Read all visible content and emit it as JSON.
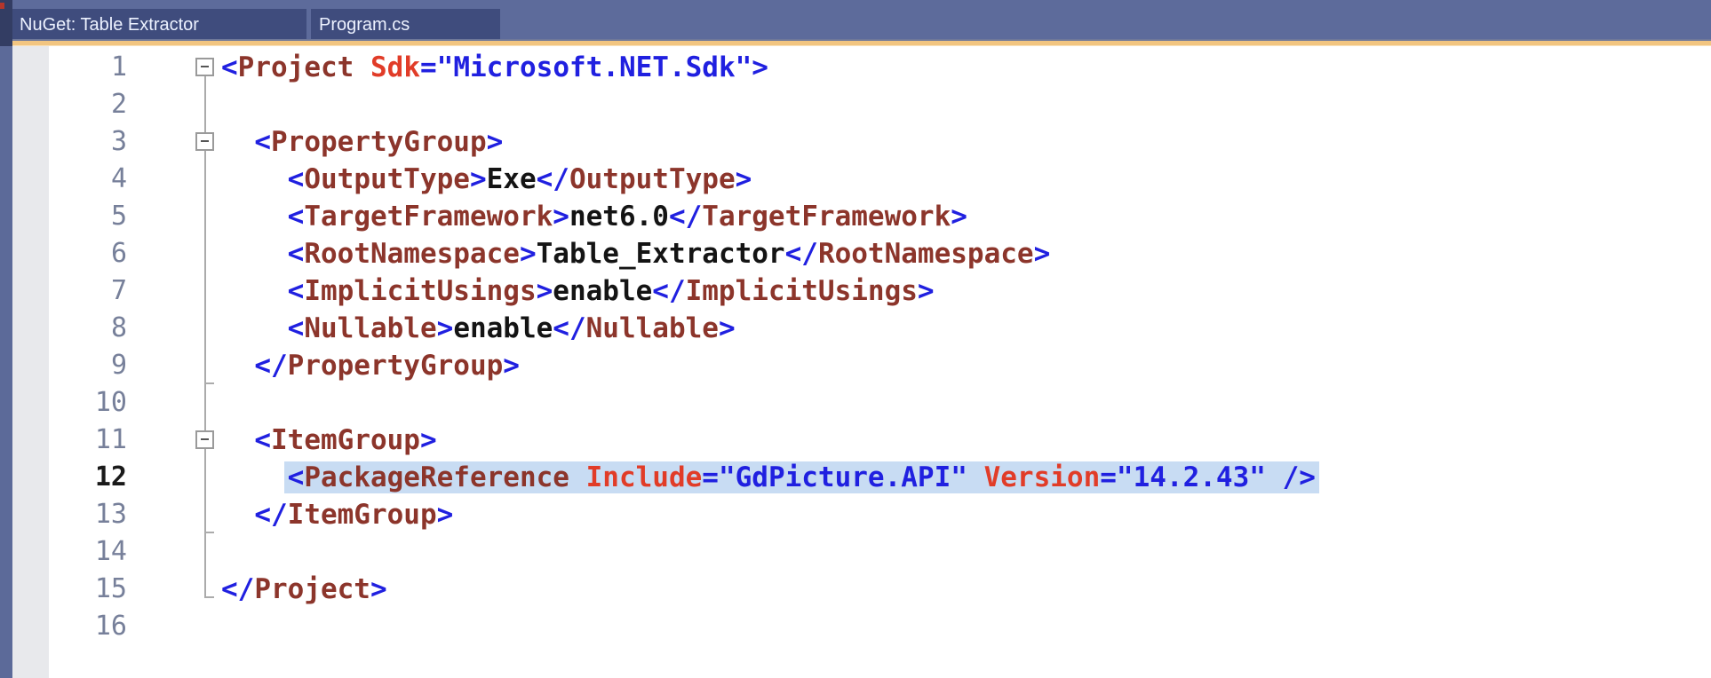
{
  "tabs": [
    {
      "label": "NuGet: Table Extractor",
      "active": true
    },
    {
      "label": "Program.cs",
      "active": false
    }
  ],
  "colors": {
    "tabbar_bg": "#5D6B9B",
    "tab_bg": "#3F4C7D",
    "tab_text": "#EDF2FF",
    "accent_border": "#F2C580",
    "window_left_edge": "#333D63",
    "editor_left_strip": "#5C6A99",
    "glyph_margin": "#E8E9EC",
    "editor_bg": "#FFFFFF",
    "line_number": "#77809A",
    "line_number_active": "#1A1A1A",
    "fold_gray": "#ABABAB",
    "selection_highlight": "#C8DCF3",
    "syntax_delimiter": "#2020E0",
    "syntax_element": "#8C352B",
    "syntax_attribute": "#E13C28",
    "syntax_value": "#2020E0",
    "syntax_text": "#141414"
  },
  "editor": {
    "language": "xml-csproj",
    "lines": [
      {
        "n": "1",
        "fold": "box-first",
        "tokens": [
          [
            "d",
            "<"
          ],
          [
            "e",
            "Project"
          ],
          [
            "w",
            " "
          ],
          [
            "a",
            "Sdk"
          ],
          [
            "d",
            "="
          ],
          [
            "v",
            "\"Microsoft.NET.Sdk\""
          ],
          [
            "d",
            ">"
          ]
        ]
      },
      {
        "n": "2",
        "fold": "line",
        "tokens": []
      },
      {
        "n": "3",
        "fold": "box",
        "tokens": [
          [
            "w",
            "  "
          ],
          [
            "d",
            "<"
          ],
          [
            "e",
            "PropertyGroup"
          ],
          [
            "d",
            ">"
          ]
        ]
      },
      {
        "n": "4",
        "fold": "line",
        "tokens": [
          [
            "w",
            "    "
          ],
          [
            "d",
            "<"
          ],
          [
            "e",
            "OutputType"
          ],
          [
            "d",
            ">"
          ],
          [
            "x",
            "Exe"
          ],
          [
            "d",
            "</"
          ],
          [
            "e",
            "OutputType"
          ],
          [
            "d",
            ">"
          ]
        ]
      },
      {
        "n": "5",
        "fold": "line",
        "tokens": [
          [
            "w",
            "    "
          ],
          [
            "d",
            "<"
          ],
          [
            "e",
            "TargetFramework"
          ],
          [
            "d",
            ">"
          ],
          [
            "x",
            "net6.0"
          ],
          [
            "d",
            "</"
          ],
          [
            "e",
            "TargetFramework"
          ],
          [
            "d",
            ">"
          ]
        ]
      },
      {
        "n": "6",
        "fold": "line",
        "tokens": [
          [
            "w",
            "    "
          ],
          [
            "d",
            "<"
          ],
          [
            "e",
            "RootNamespace"
          ],
          [
            "d",
            ">"
          ],
          [
            "x",
            "Table_Extractor"
          ],
          [
            "d",
            "</"
          ],
          [
            "e",
            "RootNamespace"
          ],
          [
            "d",
            ">"
          ]
        ]
      },
      {
        "n": "7",
        "fold": "line",
        "tokens": [
          [
            "w",
            "    "
          ],
          [
            "d",
            "<"
          ],
          [
            "e",
            "ImplicitUsings"
          ],
          [
            "d",
            ">"
          ],
          [
            "x",
            "enable"
          ],
          [
            "d",
            "</"
          ],
          [
            "e",
            "ImplicitUsings"
          ],
          [
            "d",
            ">"
          ]
        ]
      },
      {
        "n": "8",
        "fold": "line",
        "tokens": [
          [
            "w",
            "    "
          ],
          [
            "d",
            "<"
          ],
          [
            "e",
            "Nullable"
          ],
          [
            "d",
            ">"
          ],
          [
            "x",
            "enable"
          ],
          [
            "d",
            "</"
          ],
          [
            "e",
            "Nullable"
          ],
          [
            "d",
            ">"
          ]
        ]
      },
      {
        "n": "9",
        "fold": "tick",
        "tokens": [
          [
            "w",
            "  "
          ],
          [
            "d",
            "</"
          ],
          [
            "e",
            "PropertyGroup"
          ],
          [
            "d",
            ">"
          ]
        ]
      },
      {
        "n": "10",
        "fold": "line",
        "tokens": []
      },
      {
        "n": "11",
        "fold": "box",
        "tokens": [
          [
            "w",
            "  "
          ],
          [
            "d",
            "<"
          ],
          [
            "e",
            "ItemGroup"
          ],
          [
            "d",
            ">"
          ]
        ]
      },
      {
        "n": "12",
        "fold": "line",
        "active": true,
        "hl_from": 1,
        "tokens": [
          [
            "w",
            "    "
          ],
          [
            "d",
            "<"
          ],
          [
            "e",
            "PackageReference"
          ],
          [
            "w",
            " "
          ],
          [
            "a",
            "Include"
          ],
          [
            "d",
            "="
          ],
          [
            "v",
            "\"GdPicture.API\""
          ],
          [
            "w",
            " "
          ],
          [
            "a",
            "Version"
          ],
          [
            "d",
            "="
          ],
          [
            "v",
            "\"14.2.43\""
          ],
          [
            "w",
            " "
          ],
          [
            "d",
            "/>"
          ]
        ]
      },
      {
        "n": "13",
        "fold": "tick",
        "tokens": [
          [
            "w",
            "  "
          ],
          [
            "d",
            "</"
          ],
          [
            "e",
            "ItemGroup"
          ],
          [
            "d",
            ">"
          ]
        ]
      },
      {
        "n": "14",
        "fold": "line",
        "tokens": []
      },
      {
        "n": "15",
        "fold": "corner",
        "tokens": [
          [
            "d",
            "</"
          ],
          [
            "e",
            "Project"
          ],
          [
            "d",
            ">"
          ]
        ]
      },
      {
        "n": "16",
        "fold": "none",
        "tokens": []
      }
    ]
  }
}
